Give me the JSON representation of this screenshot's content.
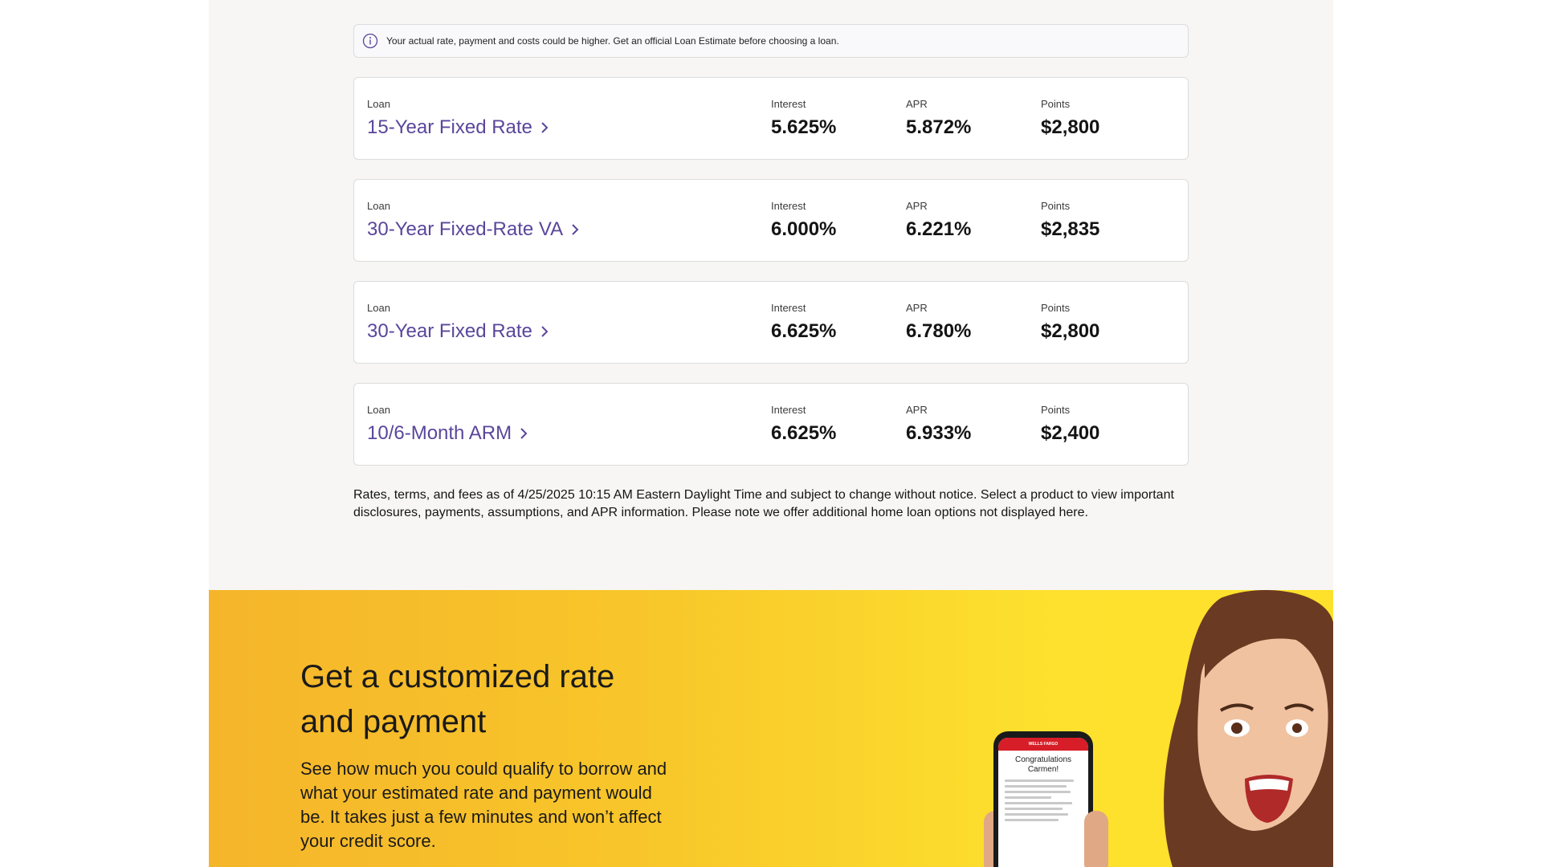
{
  "notice": {
    "icon": "info-icon",
    "text": "Your actual rate, payment and costs could be higher. Get an official Loan Estimate before choosing a loan."
  },
  "columns": {
    "loan": "Loan",
    "interest": "Interest",
    "apr": "APR",
    "points": "Points"
  },
  "rates": [
    {
      "loan": "15-Year Fixed Rate",
      "interest": "5.625%",
      "apr": "5.872%",
      "points": "$2,800"
    },
    {
      "loan": "30-Year Fixed-Rate VA",
      "interest": "6.000%",
      "apr": "6.221%",
      "points": "$2,835"
    },
    {
      "loan": "30-Year Fixed Rate",
      "interest": "6.625%",
      "apr": "6.780%",
      "points": "$2,800"
    },
    {
      "loan": "10/6-Month ARM",
      "interest": "6.625%",
      "apr": "6.933%",
      "points": "$2,400"
    }
  ],
  "disclaimer": "Rates, terms, and fees as of 4/25/2025 10:15 AM Eastern Daylight Time and subject to change without notice. Select a product to view important disclosures, payments, assumptions, and APR information. Please note we offer additional home loan options not displayed here.",
  "promo": {
    "title": "Get a customized rate and payment",
    "body": "See how much you could qualify to borrow and what your estimated rate and payment would be. It takes just a few minutes and won’t affect your credit score.",
    "phone": {
      "brand": "WELLS FARGO",
      "heading_line1": "Congratulations",
      "heading_line2": "Carmen!"
    }
  },
  "colors": {
    "link": "#5a469b",
    "page_bg": "#f7f6f5",
    "promo_yellow": "#fde12e",
    "brand_red": "#d71e28"
  }
}
